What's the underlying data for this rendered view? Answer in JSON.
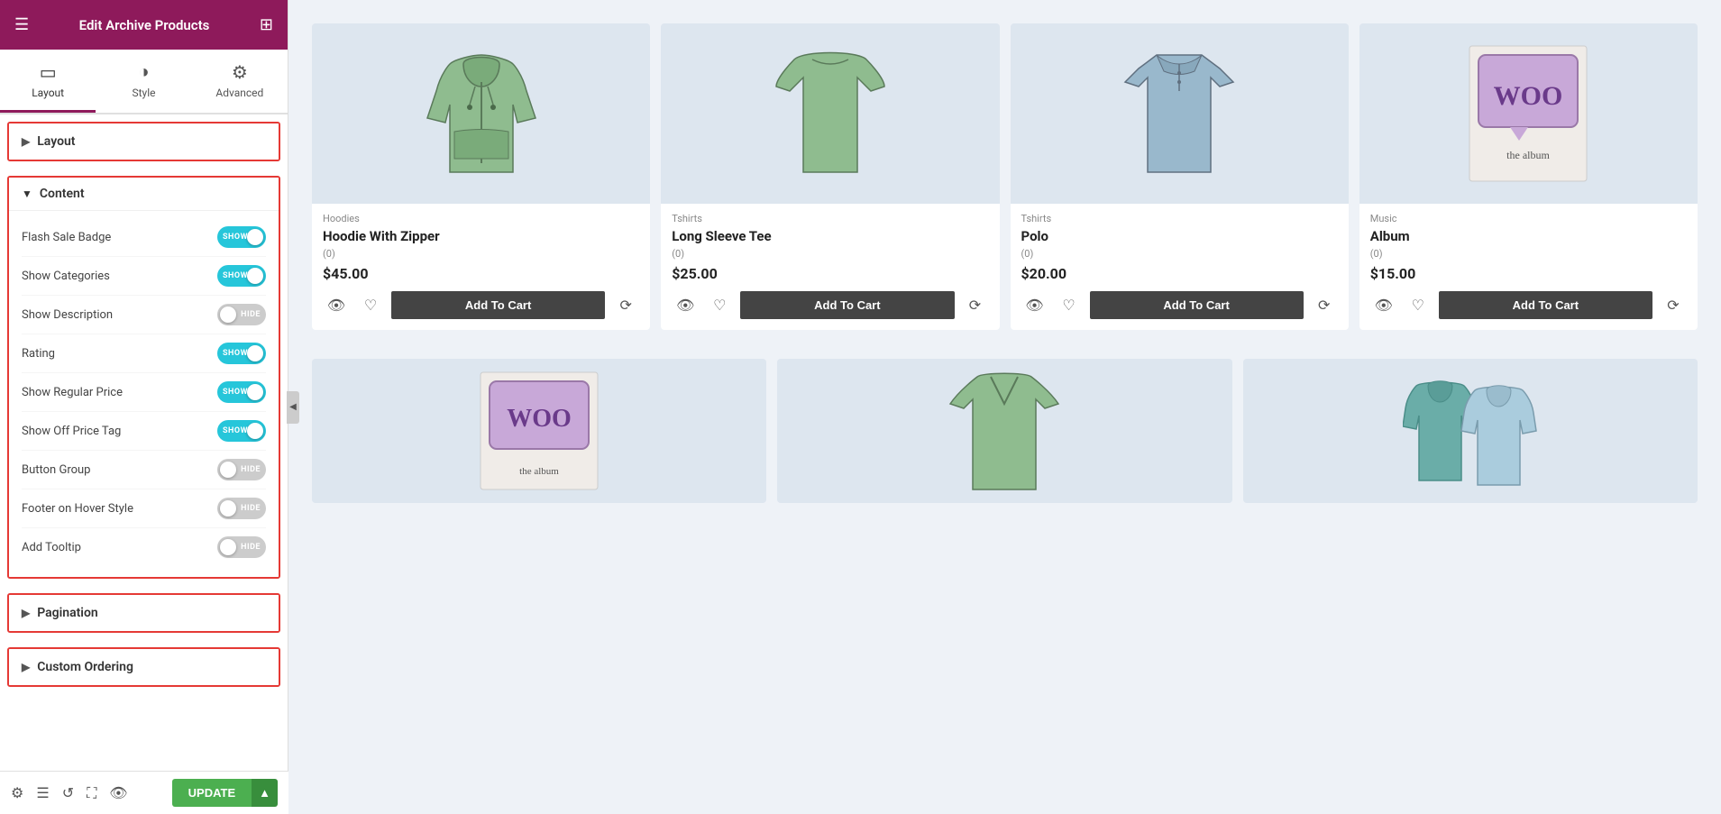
{
  "header": {
    "title": "Edit Archive Products",
    "hamburger": "☰",
    "grid": "⊞"
  },
  "tabs": [
    {
      "id": "layout",
      "label": "Layout",
      "icon": "▭",
      "active": true
    },
    {
      "id": "style",
      "label": "Style",
      "icon": "◑",
      "active": false
    },
    {
      "id": "advanced",
      "label": "Advanced",
      "icon": "⚙",
      "active": false
    }
  ],
  "sections": {
    "layout": {
      "label": "Layout",
      "expanded": false
    },
    "content": {
      "label": "Content",
      "expanded": true,
      "toggles": [
        {
          "id": "flash-sale-badge",
          "label": "Flash Sale Badge",
          "state": "show"
        },
        {
          "id": "show-categories",
          "label": "Show Categories",
          "state": "show"
        },
        {
          "id": "show-description",
          "label": "Show Description",
          "state": "hide"
        },
        {
          "id": "rating",
          "label": "Rating",
          "state": "show"
        },
        {
          "id": "show-regular-price",
          "label": "Show Regular Price",
          "state": "show"
        },
        {
          "id": "show-off-price-tag",
          "label": "Show Off Price Tag",
          "state": "show"
        },
        {
          "id": "button-group",
          "label": "Button Group",
          "state": "hide"
        },
        {
          "id": "footer-on-hover-style",
          "label": "Footer on Hover Style",
          "state": "hide"
        },
        {
          "id": "add-tooltip",
          "label": "Add Tooltip",
          "state": "hide"
        }
      ]
    },
    "pagination": {
      "label": "Pagination",
      "expanded": false
    },
    "custom-ordering": {
      "label": "Custom Ordering",
      "expanded": false
    }
  },
  "products": [
    {
      "id": "hoodie-zipper",
      "category": "Hoodies",
      "name": "Hoodie With Zipper",
      "rating": "(0)",
      "price": "$45.00",
      "color": "#b0ccb0",
      "type": "hoodie"
    },
    {
      "id": "long-sleeve-tee",
      "category": "Tshirts",
      "name": "Long Sleeve Tee",
      "rating": "(0)",
      "price": "$25.00",
      "color": "#b0ccb0",
      "type": "longsleeve"
    },
    {
      "id": "polo",
      "category": "Tshirts",
      "name": "Polo",
      "rating": "(0)",
      "price": "$20.00",
      "color": "#aabccc",
      "type": "polo"
    },
    {
      "id": "album",
      "category": "Music",
      "name": "Album",
      "rating": "(0)",
      "price": "$15.00",
      "color": "#e0dae8",
      "type": "woo"
    }
  ],
  "row2_products": [
    {
      "id": "woo2",
      "category": "",
      "name": "",
      "rating": "",
      "price": "",
      "type": "woo2"
    },
    {
      "id": "tshirt2",
      "category": "",
      "name": "",
      "rating": "",
      "price": "",
      "type": "tshirt2"
    },
    {
      "id": "hoodies2",
      "category": "",
      "name": "",
      "rating": "",
      "price": "",
      "type": "hoodies2"
    }
  ],
  "buttons": {
    "update_label": "UPDATE",
    "update_arrow": "▲"
  },
  "bottom_icons": [
    "⚙",
    "☰",
    "↺",
    "⛶",
    "👁"
  ]
}
